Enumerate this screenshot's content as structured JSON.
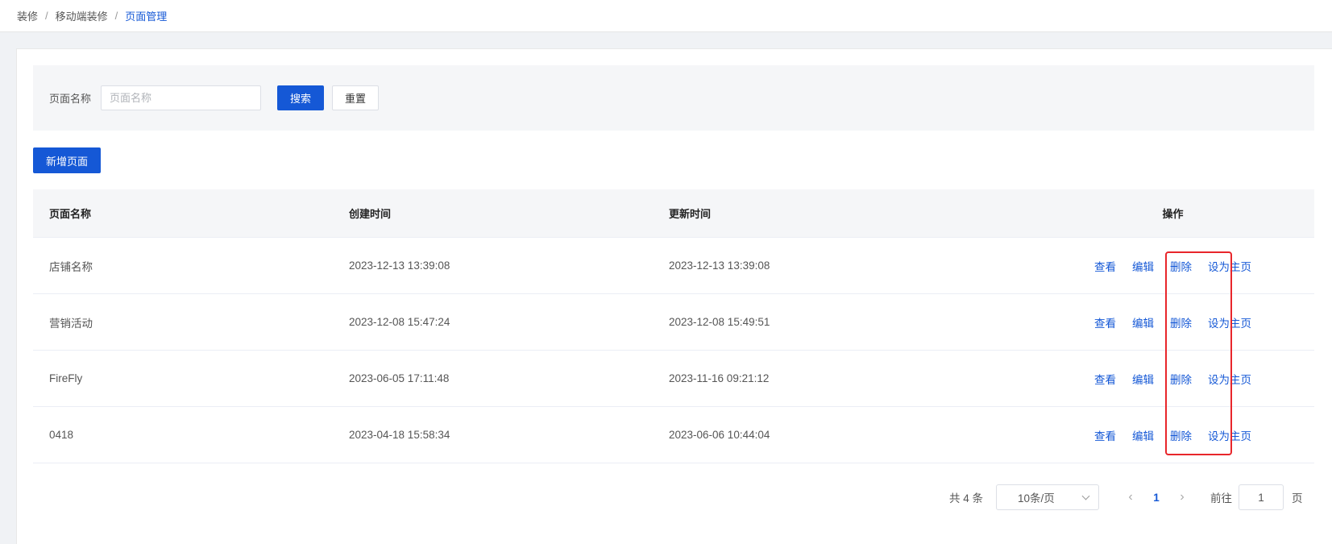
{
  "breadcrumb": {
    "items": [
      "装修",
      "移动端装修",
      "页面管理"
    ],
    "separator": "/"
  },
  "search": {
    "label": "页面名称",
    "placeholder": "页面名称",
    "search_label": "搜索",
    "reset_label": "重置"
  },
  "toolbar": {
    "add_label": "新增页面"
  },
  "table": {
    "columns": [
      "页面名称",
      "创建时间",
      "更新时间",
      "操作"
    ],
    "rows": [
      {
        "name": "店铺名称",
        "created": "2023-12-13 13:39:08",
        "updated": "2023-12-13 13:39:08"
      },
      {
        "name": "营销活动",
        "created": "2023-12-08 15:47:24",
        "updated": "2023-12-08 15:49:51"
      },
      {
        "name": "FireFly",
        "created": "2023-06-05 17:11:48",
        "updated": "2023-11-16 09:21:12"
      },
      {
        "name": "0418",
        "created": "2023-04-18 15:58:34",
        "updated": "2023-06-06 10:44:04"
      }
    ],
    "actions": {
      "view": "查看",
      "edit": "编辑",
      "delete": "删除",
      "set_home": "设为主页"
    }
  },
  "pagination": {
    "total": "共 4 条",
    "page_size": "10条/页",
    "current_page": "1",
    "goto_label": "前往",
    "goto_value": "1",
    "page_suffix": "页"
  },
  "colors": {
    "primary": "#1558d6",
    "highlight": "#e8262b"
  }
}
